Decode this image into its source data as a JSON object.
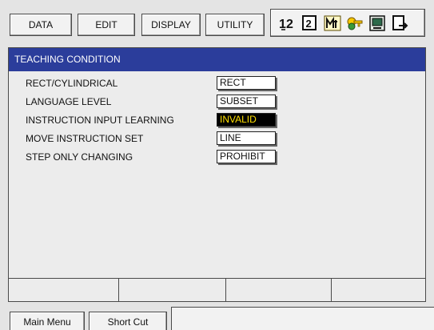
{
  "menu": {
    "data": "DATA",
    "edit": "EDIT",
    "display": "DISPLAY",
    "utility": "UTILITY"
  },
  "toolbar_icons": [
    "numbering-icon",
    "step-number-icon",
    "pendant-mode-icon",
    "security-key-icon",
    "monitor-icon",
    "exit-icon"
  ],
  "panel": {
    "title": "TEACHING CONDITION",
    "rows": [
      {
        "label": "RECT/CYLINDRICAL",
        "value": "RECT"
      },
      {
        "label": "LANGUAGE LEVEL",
        "value": "SUBSET"
      },
      {
        "label": "INSTRUCTION INPUT LEARNING",
        "value": "INVALID"
      },
      {
        "label": "MOVE INSTRUCTION SET",
        "value": "LINE"
      },
      {
        "label": "STEP ONLY CHANGING",
        "value": "PROHIBIT"
      }
    ]
  },
  "bottom": {
    "main_menu": "Main Menu",
    "short_cut": "Short Cut"
  },
  "colors": {
    "title_bar": "#2b3d9b",
    "selected_bg": "#000000",
    "selected_text": "#ffe000"
  }
}
